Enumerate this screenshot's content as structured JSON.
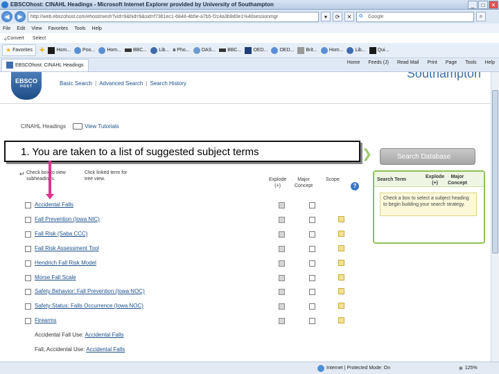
{
  "window": {
    "title": "EBSCOhost: CINAHL Headings - Microsoft Internet Explorer provided by University of Southampton",
    "controls": [
      "_",
      "□",
      "✕"
    ]
  },
  "address": {
    "url": "http://web.ebscohost.com/ehost/mesh?vid=9&hid=9&sid=f7361ec1-6848-4b5e-a7b5-f2c4a3b9d0e1%40sessionmgr",
    "search_placeholder": "Google"
  },
  "menu": {
    "items": [
      "File",
      "Edit",
      "View",
      "Favorites",
      "Tools",
      "Help"
    ],
    "extra": [
      "¿Convert",
      "Select"
    ]
  },
  "favorites": {
    "button_label": "Favorites",
    "items": [
      {
        "label": "Hom...",
        "color": "#1a1a1a"
      },
      {
        "label": "Poo...",
        "color": "#5a8fd6"
      },
      {
        "label": "Hom...",
        "color": "#5a8fd6"
      },
      {
        "label": "BBC...",
        "color": "#333333"
      },
      {
        "label": "Lib...",
        "color": "#3e6cae"
      },
      {
        "label": "Pho...",
        "color": "#222222"
      },
      {
        "label": "OAS...",
        "color": "#6b9bd1"
      },
      {
        "label": "BBC...",
        "color": "#333333"
      },
      {
        "label": "OED...",
        "color": "#1f3f7a"
      },
      {
        "label": "OED...",
        "color": "#5a8fd6"
      },
      {
        "label": "Brit...",
        "color": "#999999"
      },
      {
        "label": "Hom...",
        "color": "#5a8fd6"
      },
      {
        "label": "Lib...",
        "color": "#3e6cae"
      },
      {
        "label": "Qui...",
        "color": "#1a1a1a"
      }
    ]
  },
  "tab": {
    "label": "EBSCOhost: CINAHL Headings",
    "tools": [
      "Home",
      "Feeds (J)",
      "Read Mail",
      "Print",
      "Page",
      "Tools",
      "Help"
    ]
  },
  "header": {
    "logo_text": "EBSCO",
    "logo_sub": "HOST",
    "nav": [
      "Basic Search",
      "Advanced Search",
      "Search History"
    ],
    "brand": "Southampton"
  },
  "crumbs": {
    "current": "CINAHL Headings",
    "tutorials": "View Tutorials"
  },
  "callout": {
    "text": "1. You are taken to a list of suggested subject terms"
  },
  "instructions": {
    "check": "Check box to view subheadings.",
    "click": "Click linked term for tree view."
  },
  "columns": {
    "explode": "Explode",
    "explode_sub": "(+)",
    "major": "Major",
    "major_sub": "Concept",
    "scope": "Scope",
    "help": "?"
  },
  "terms": [
    {
      "label": "Accidental Falls",
      "linked": true,
      "scope": false
    },
    {
      "label": "Fall Prevention (Iowa NIC)",
      "linked": true,
      "scope": true
    },
    {
      "label": "Fall Risk (Saba CCC)",
      "linked": true,
      "scope": true
    },
    {
      "label": "Fall Risk Assessment Tool",
      "linked": true,
      "scope": true
    },
    {
      "label": "Hendrich Fall Risk Model",
      "linked": true,
      "scope": true
    },
    {
      "label": "Morse Fall Scale",
      "linked": true,
      "scope": true
    },
    {
      "label": "Safety Behavior: Fall Prevention (Iowa NOC)",
      "linked": true,
      "scope": true
    },
    {
      "label": "Safety Status: Falls Occurrence (Iowa NOC)",
      "linked": true,
      "scope": true
    },
    {
      "label": "Firearms",
      "linked": true,
      "scope": true
    }
  ],
  "see_refs": [
    {
      "prefix": "Accidental Fall Use:",
      "link": "Accidental Falls"
    },
    {
      "prefix": "Fall, Accidental Use:",
      "link": "Accidental Falls"
    }
  ],
  "sidebar": {
    "search_button": "Search Database",
    "col_term": "Search Term",
    "col_explode": "Explode",
    "col_explode_sub": "(+)",
    "col_major": "Major",
    "col_major_sub": "Concept",
    "hint": "Check a box to select a subject heading to begin building your search strategy."
  },
  "status": {
    "zone": "Internet | Protected Mode: On",
    "zoom": "125%"
  }
}
